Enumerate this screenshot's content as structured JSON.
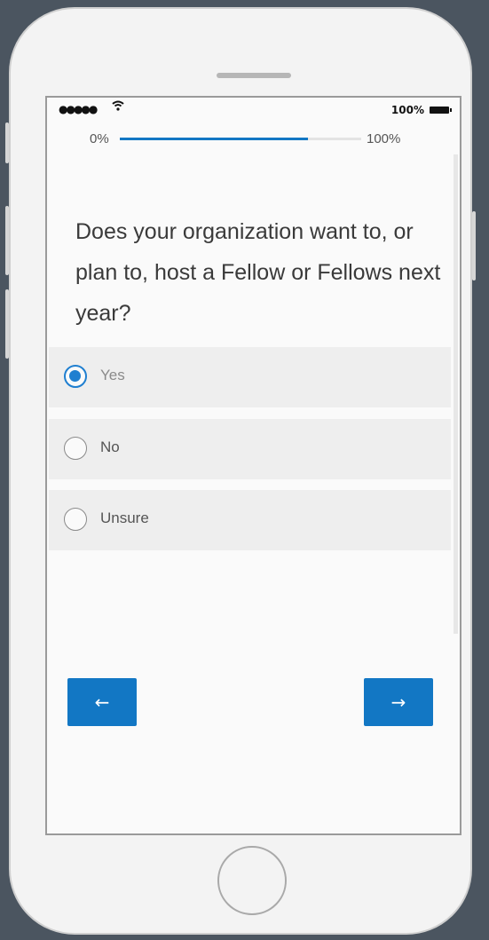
{
  "status_bar": {
    "signal": "●●●●●",
    "wifi_icon": "wifi-icon",
    "battery_percent": "100%",
    "battery_icon": "battery-icon"
  },
  "progress": {
    "start_label": "0%",
    "end_label": "100%",
    "value": 0.78
  },
  "question": {
    "text": "Does your organization want to, or plan to, host a Fellow or Fellows next year?"
  },
  "options": [
    {
      "label": "Yes",
      "selected": true
    },
    {
      "label": "No",
      "selected": false
    },
    {
      "label": "Unsure",
      "selected": false
    }
  ],
  "navigation": {
    "back_label": "←",
    "next_label": "→",
    "button_color": "#1277c4"
  },
  "colors": {
    "accent": "#1f7fd0",
    "background": "#4b5560"
  }
}
